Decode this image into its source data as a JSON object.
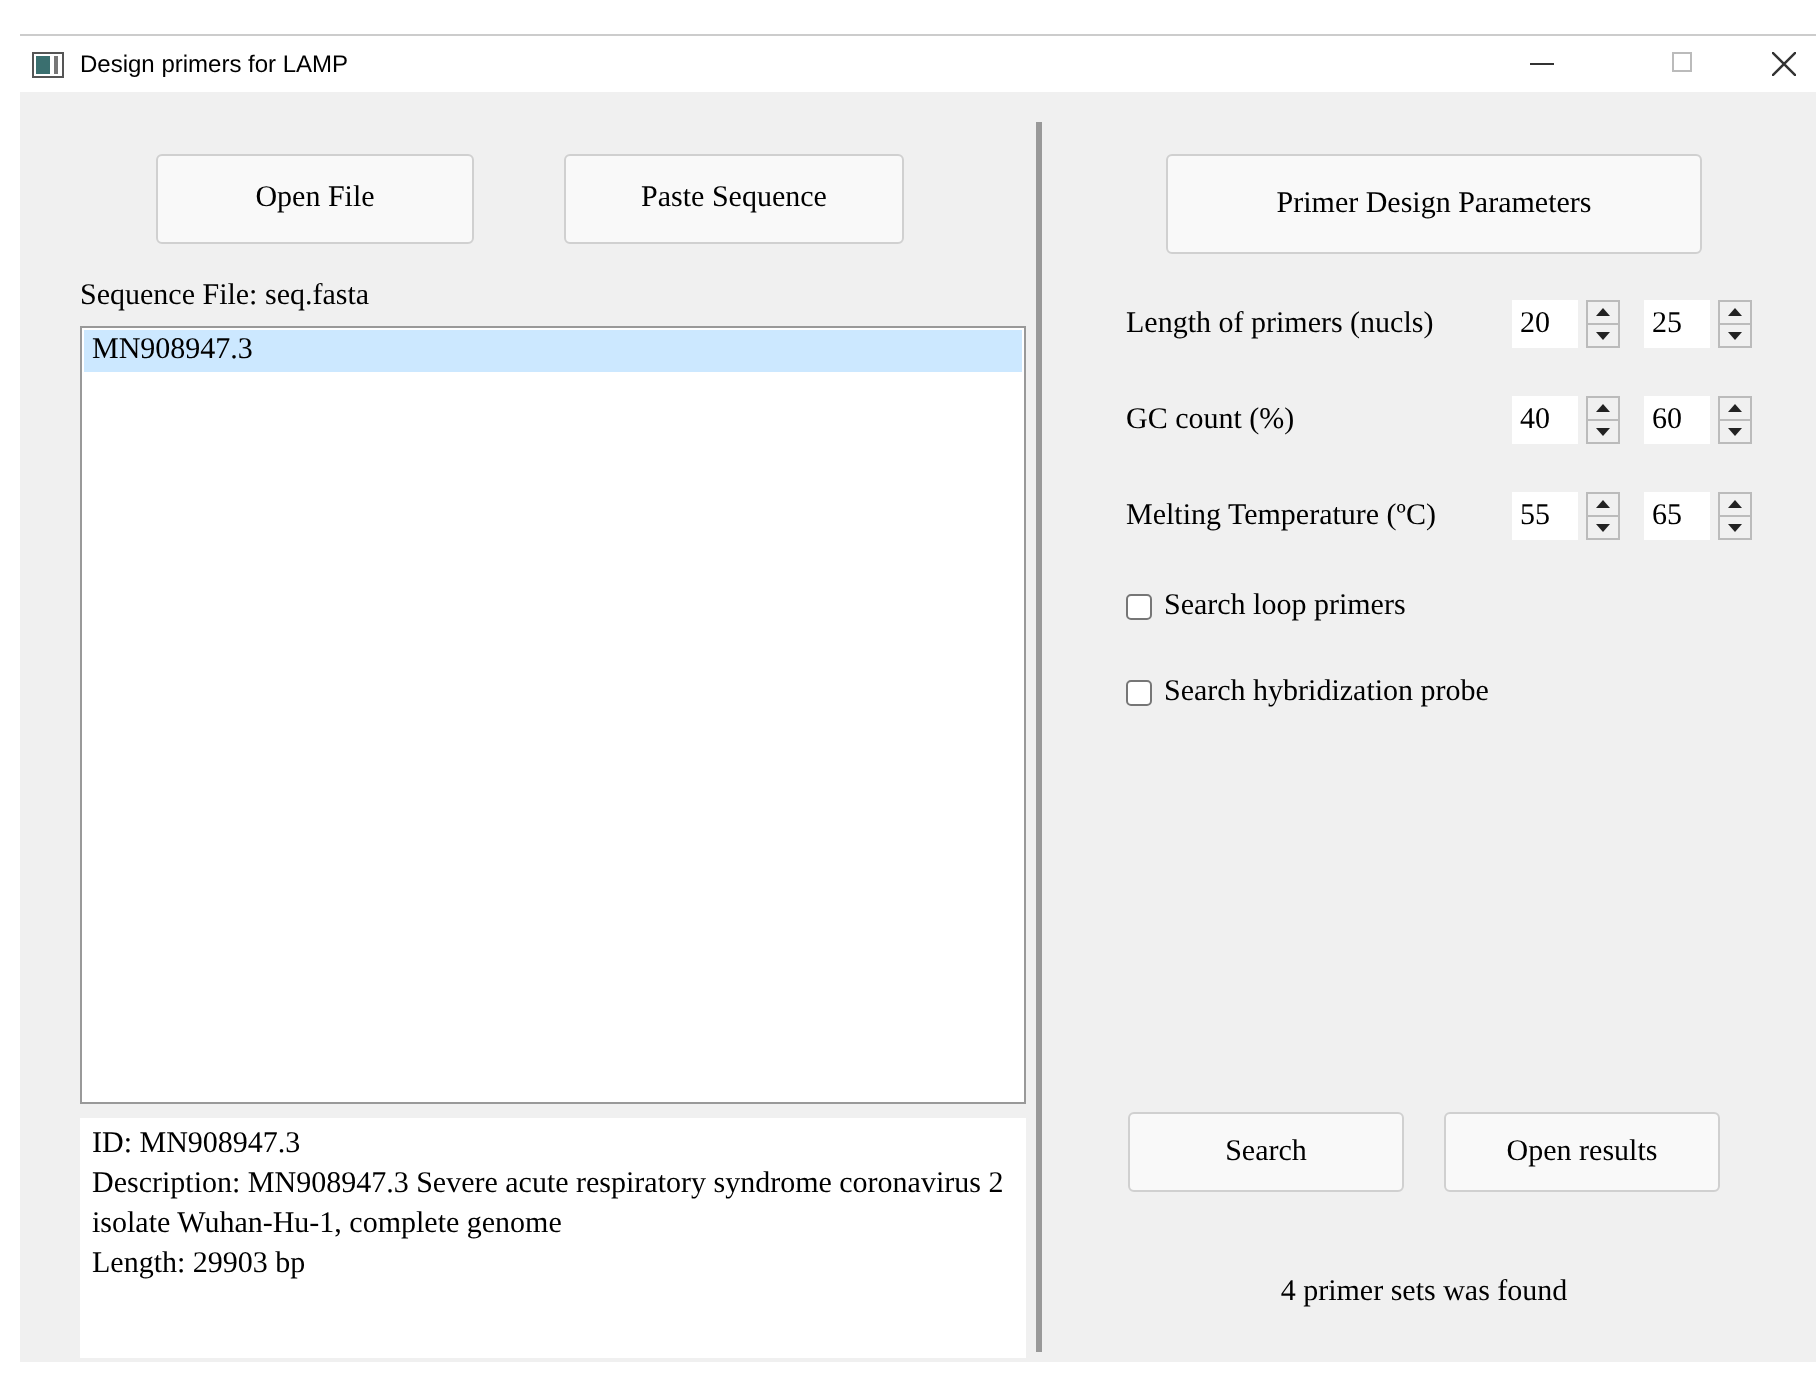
{
  "window": {
    "title": "Design primers for LAMP"
  },
  "file_buttons": [
    "Open File",
    "Paste Sequence"
  ],
  "sequence_file_label": "Sequence File: seq.fasta",
  "sequences": [
    {
      "label": "MN908947.3",
      "selected": true
    }
  ],
  "info": [
    "ID: MN908947.3",
    "Description: MN908947.3 Severe acute respiratory syndrome coronavirus 2 isolate Wuhan-Hu-1, complete genome",
    "Length: 29903 bp"
  ],
  "parameters_button": "Primer Design Parameters",
  "parameters": [
    {
      "label": "Length of primers (nucls)",
      "min": "20",
      "max": "25"
    },
    {
      "label": "GC count (%)",
      "min": "40",
      "max": "60"
    },
    {
      "label": "Melting Temperature (ºC)",
      "min": "55",
      "max": "65"
    }
  ],
  "options": [
    {
      "label": "Search loop primers",
      "checked": false
    },
    {
      "label": "Search hybridization probe",
      "checked": false
    }
  ],
  "action_buttons": [
    "Search",
    "Open results"
  ],
  "status": "4 primer sets was found"
}
